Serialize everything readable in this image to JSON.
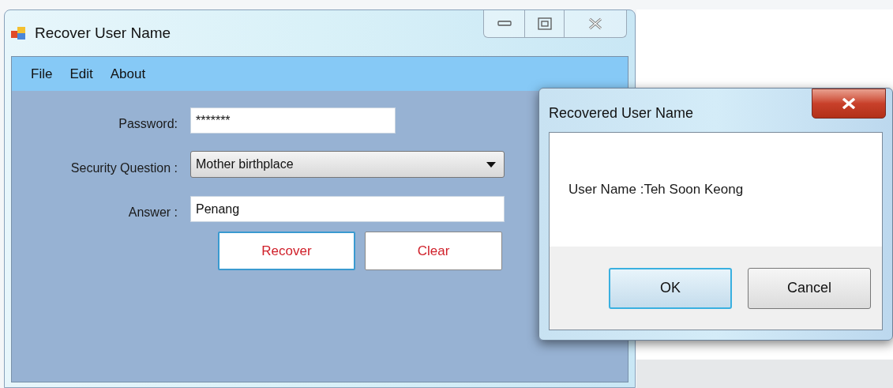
{
  "main_window": {
    "title": "Recover User Name",
    "menu": [
      {
        "label": "File"
      },
      {
        "label": "Edit"
      },
      {
        "label": "About"
      }
    ],
    "fields": [
      {
        "kind": "input",
        "label": "Password:",
        "value": "*******"
      },
      {
        "kind": "select",
        "label": "Security Question :",
        "value": "Mother birthplace"
      },
      {
        "kind": "input",
        "label": "Answer :",
        "value": "Penang"
      }
    ],
    "buttons": [
      {
        "label": "Recover",
        "focused": true
      },
      {
        "label": "Clear",
        "focused": false
      }
    ]
  },
  "dialog": {
    "title": "Recovered User Name",
    "message": "User Name :Teh Soon Keong",
    "buttons": [
      {
        "label": "OK",
        "focused": true
      },
      {
        "label": "Cancel",
        "focused": false
      }
    ]
  }
}
